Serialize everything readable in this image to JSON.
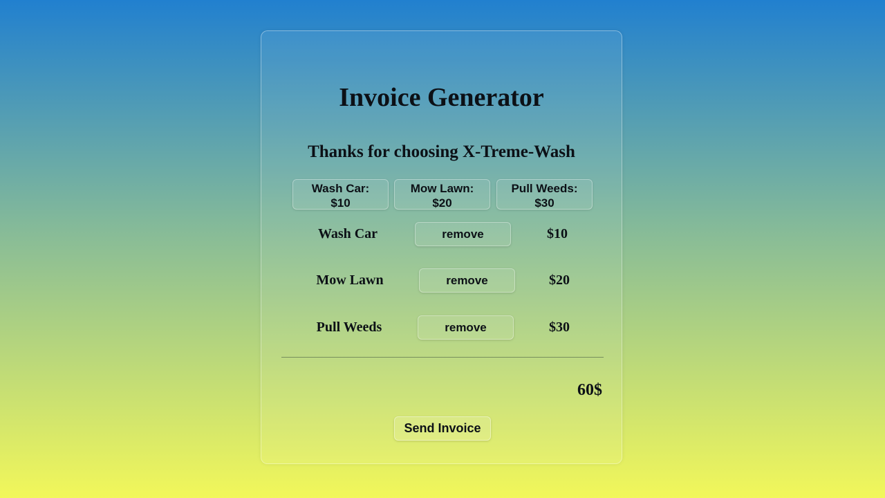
{
  "header": {
    "title": "Invoice Generator",
    "subtitle": "Thanks for choosing X-Treme-Wash"
  },
  "services": [
    {
      "name": "Wash Car:",
      "price": "$10"
    },
    {
      "name": "Mow Lawn:",
      "price": "$20"
    },
    {
      "name": "Pull Weeds:",
      "price": "$30"
    }
  ],
  "invoice_items": [
    {
      "name": "Wash Car",
      "action": "remove",
      "price": "$10"
    },
    {
      "name": "Mow Lawn",
      "action": "remove",
      "price": "$20"
    },
    {
      "name": "Pull Weeds",
      "action": "remove",
      "price": "$30"
    }
  ],
  "total": "60$",
  "send_button": "Send Invoice",
  "colors": {
    "gradient_top": "#2180cf",
    "gradient_bottom": "#f2f75a",
    "text": "#0c1016"
  }
}
